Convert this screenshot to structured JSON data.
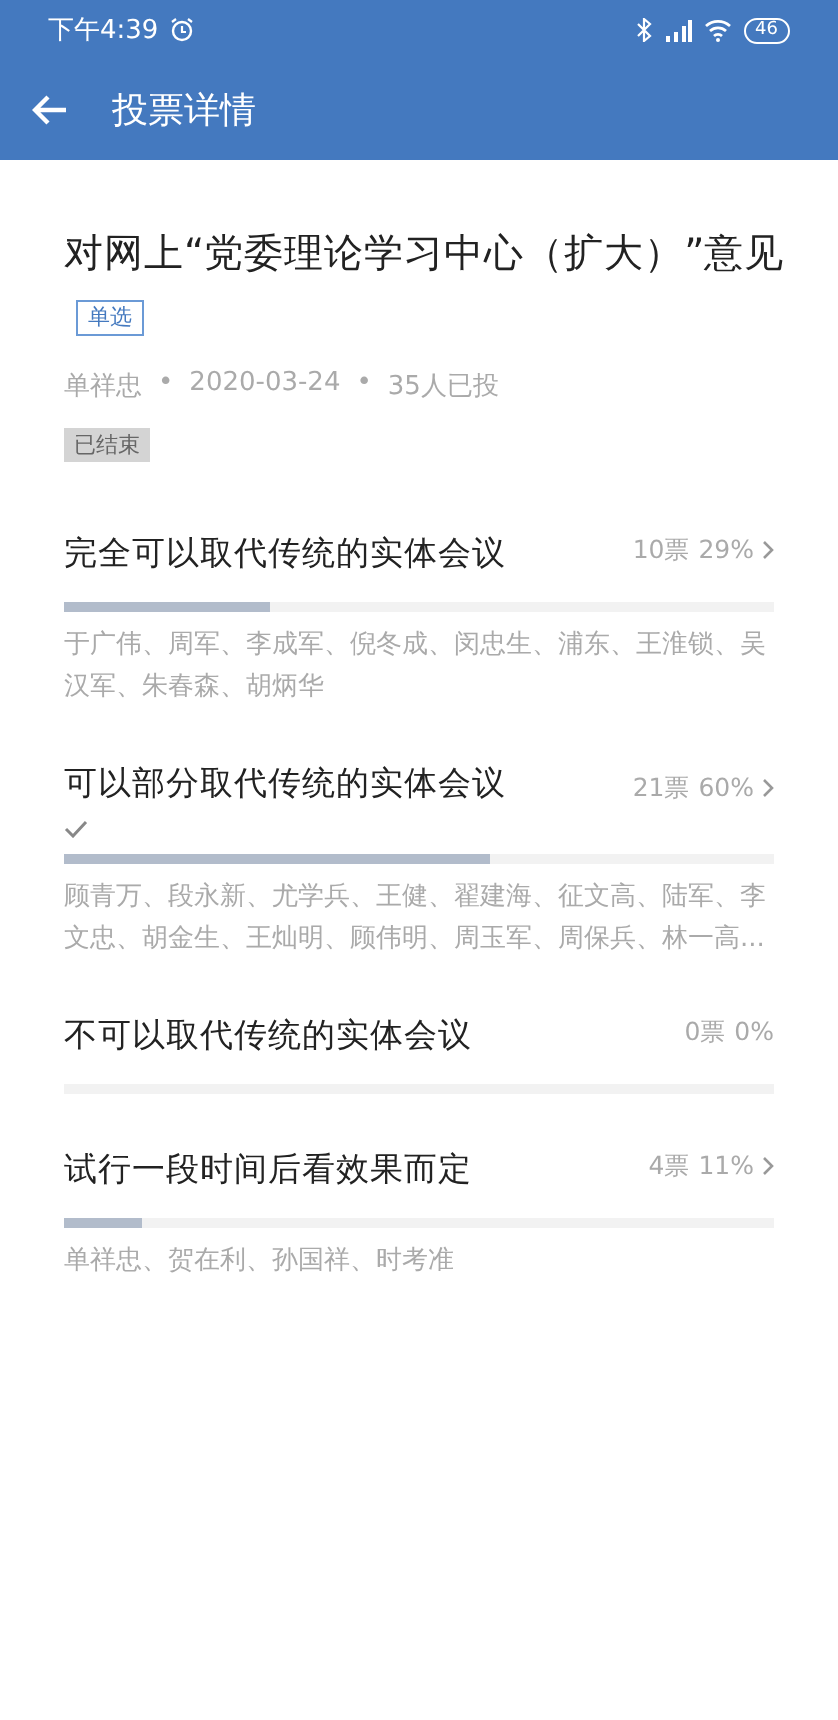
{
  "status_bar": {
    "time": "下午4:39",
    "battery": "46"
  },
  "header": {
    "title": "投票详情"
  },
  "poll": {
    "title": "对网上“党委理论学习中心（扩大）”意见",
    "type_tag": "单选",
    "author": "单祥忠",
    "date": "2020-03-24",
    "count": "35人已投",
    "separator": "•",
    "status": "已结束"
  },
  "options": [
    {
      "label": "完全可以取代传统的实体会议",
      "result": "10票 29%",
      "level": 0.29,
      "selected": false,
      "has_arrow": true,
      "voters": "于广伟、周军、李成军、倪冬成、闵忠生、浦东、王淮锁、吴汉军、朱春森、胡炳华"
    },
    {
      "label": "可以部分取代传统的实体会议",
      "result": "21票 60%",
      "level": 0.6,
      "selected": true,
      "has_arrow": true,
      "voters": "顾青万、段永新、尤学兵、王健、翟建海、征文高、陆军、李文忠、胡金生、王灿明、顾伟明、周玉军、周保兵、林一高..."
    },
    {
      "label": "不可以取代传统的实体会议",
      "result": "0票 0%",
      "level": 0,
      "selected": false,
      "has_arrow": false
    },
    {
      "label": "试行一段时间后看效果而定",
      "result": "4票 11%",
      "level": 0.11,
      "selected": false,
      "has_arrow": true,
      "voters": "单祥忠、贺在利、孙国祥、时考准"
    }
  ]
}
